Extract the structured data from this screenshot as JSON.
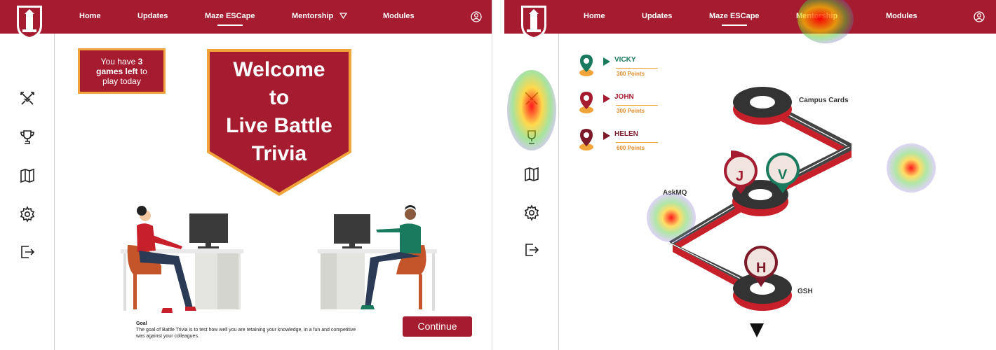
{
  "nav": {
    "home": "Home",
    "updates": "Updates",
    "maze": "Maze ESCape",
    "mentorship": "Mentorship",
    "modules": "Modules"
  },
  "colors": {
    "brand": "#a51c30",
    "accent": "#f1a43a",
    "teal": "#1a7a5e",
    "maroon": "#7d1a2a"
  },
  "sidebar_icons": [
    "swords-icon",
    "trophy-icon",
    "map-icon",
    "settings-gear-icon",
    "logout-icon"
  ],
  "left": {
    "games_prefix": "You have",
    "games_count": "3",
    "games_bold": "games left",
    "games_suffix1": "to",
    "games_suffix2": "play today",
    "banner_lines": [
      "Welcome",
      "to",
      "Live Battle",
      "Trivia"
    ],
    "goal_title": "Goal",
    "goal_text": "The goal of Battle Trivia is to test how well you are retaining your knowledge, in a fun and competitive was against your colleagues.",
    "continue_label": "Continue"
  },
  "right": {
    "leaderboard": [
      {
        "name": "VICKY",
        "points": "300 Points",
        "color": "#1a7a5e"
      },
      {
        "name": "JOHN",
        "points": "300 Points",
        "color": "#a51c30"
      },
      {
        "name": "HELEN",
        "points": "600 Points",
        "color": "#7d1a2a"
      }
    ],
    "map_labels": {
      "campus": "Campus Cards",
      "askmq": "AskMQ",
      "gsh": "GSH"
    },
    "markers": {
      "j": "J",
      "v": "V",
      "h": "H"
    }
  }
}
